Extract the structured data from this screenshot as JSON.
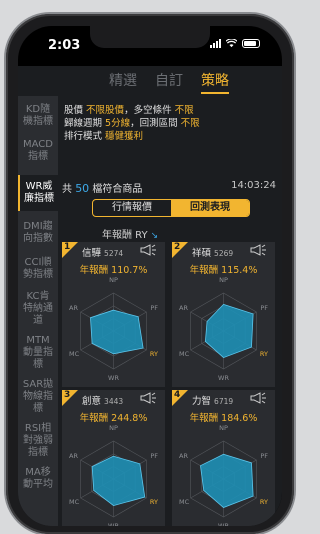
{
  "status_bar": {
    "time": "2:03"
  },
  "tabs": [
    {
      "label": "精選",
      "active": false
    },
    {
      "label": "自訂",
      "active": false
    },
    {
      "label": "策略",
      "active": true
    }
  ],
  "sidebar": [
    {
      "label": "KD隨機指標",
      "active": false
    },
    {
      "label": "MACD指標",
      "active": false
    },
    {
      "label": "WR威廉指標",
      "active": true
    },
    {
      "label": "DMI趨向指數",
      "active": false
    },
    {
      "label": "CCI順勢指標",
      "active": false
    },
    {
      "label": "KC肯特納通道",
      "active": false
    },
    {
      "label": "MTM動量指標",
      "active": false
    },
    {
      "label": "SAR拋物線指標",
      "active": false
    },
    {
      "label": "RSI相對強弱指標",
      "active": false
    },
    {
      "label": "MA移動平均",
      "active": false
    }
  ],
  "filters": {
    "line1_prefix": "股價",
    "price": "不限股價",
    "sep1": "，多空條件",
    "condition": "不限",
    "line2_prefix": "歸線週期",
    "period": "5分線",
    "sep2": "，回測區間",
    "range": "不限",
    "line3_prefix": "排行模式",
    "mode": "穩健獲利"
  },
  "count": {
    "prefix": "共",
    "number": "50",
    "suffix": "檔符合商品",
    "timestamp": "14:03:24"
  },
  "segment": {
    "left": "行情報價",
    "right": "回測表現",
    "selected": "回測表現"
  },
  "sort": {
    "label": "年報酬 RY",
    "direction": "desc"
  },
  "colors": {
    "accent": "#f2b530",
    "blue": "#3da9e8",
    "radar_fill": "#1e8fb5"
  },
  "axis_labels": {
    "top": "NP",
    "right": "PF",
    "bottom_right": "RY",
    "bottom": "WR",
    "bottom_left": "MC",
    "left": "AR"
  },
  "cards": [
    {
      "rank": "1",
      "name": "信驊",
      "code": "5274",
      "perf_label": "年報酬",
      "perf": "110.7%",
      "radar": [
        0.55,
        0.75,
        0.9,
        0.6,
        0.65,
        0.7
      ]
    },
    {
      "rank": "2",
      "name": "祥碩",
      "code": "5269",
      "perf_label": "年報酬",
      "perf": "115.4%",
      "radar": [
        0.7,
        0.9,
        0.85,
        0.7,
        0.55,
        0.5
      ]
    },
    {
      "rank": "3",
      "name": "創意",
      "code": "3443",
      "perf_label": "年報酬",
      "perf": "244.8%",
      "radar": [
        0.6,
        0.8,
        0.95,
        0.7,
        0.6,
        0.65
      ]
    },
    {
      "rank": "4",
      "name": "力智",
      "code": "6719",
      "perf_label": "年報酬",
      "perf": "184.6%",
      "radar": [
        0.65,
        0.85,
        0.9,
        0.75,
        0.6,
        0.7
      ]
    }
  ]
}
